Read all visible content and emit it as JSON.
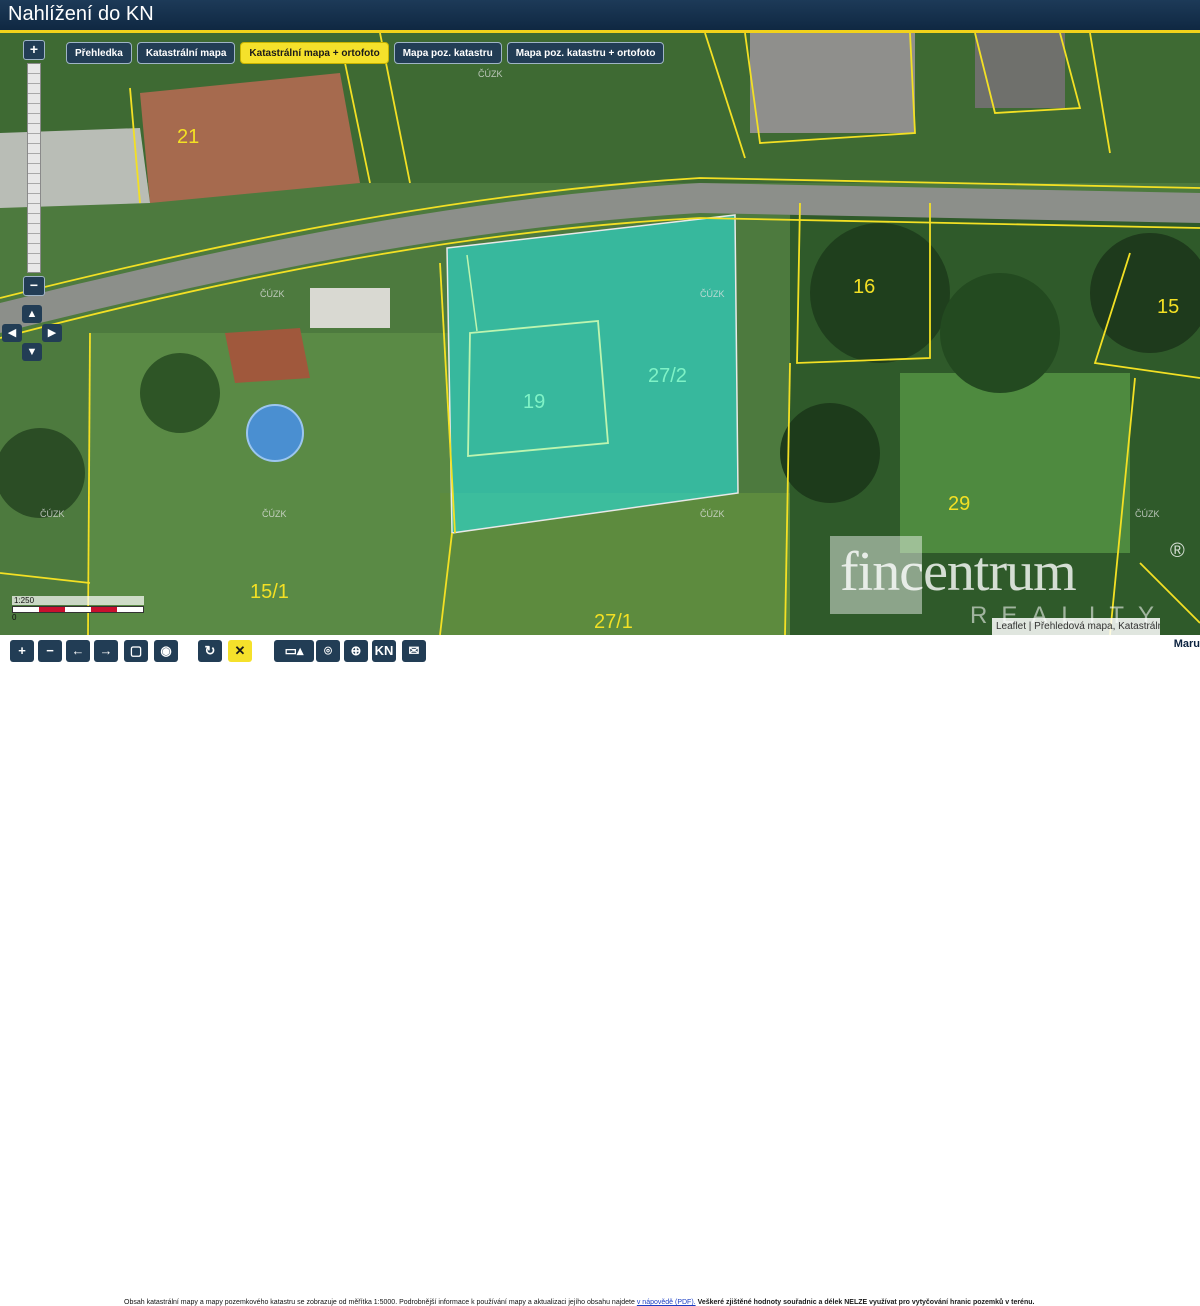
{
  "app": {
    "title": "Nahlížení do KN"
  },
  "layers": {
    "tabs": [
      {
        "label": "Přehledka",
        "active": false
      },
      {
        "label": "Katastrální mapa",
        "active": false
      },
      {
        "label": "Katastrální mapa + ortofoto",
        "active": true
      },
      {
        "label": "Mapa poz. katastru",
        "active": false
      },
      {
        "label": "Mapa poz. katastru + ortofoto",
        "active": false
      }
    ]
  },
  "zoom": {
    "in_label": "+",
    "out_label": "−"
  },
  "parcels": [
    {
      "label": "21"
    },
    {
      "label": "16"
    },
    {
      "label": "15"
    },
    {
      "label": "19"
    },
    {
      "label": "27/2"
    },
    {
      "label": "29"
    },
    {
      "label": "15/1"
    },
    {
      "label": "27/1"
    }
  ],
  "map": {
    "source_tag": "ČÚZK",
    "highlight_color": "#2fd0c2",
    "boundary_color": "#f3e024",
    "scale_label": "1:250",
    "scale_zero": "0"
  },
  "attribution": {
    "text": "Leaflet | Přehledová mapa, Katastrální mapa + o"
  },
  "watermark": {
    "brand": "fincentrum",
    "sub": "REALITY",
    "reg": "®"
  },
  "bottom_brand": "Maru",
  "toolbar": {
    "kn_label": "KN",
    "notice_text": "Obsah katastrální mapy a mapy pozemkového katastru se zobrazuje od měřítka 1:5000. Podrobnější informace k používání mapy a aktualizaci jejího obsahu najdete",
    "notice_link": "v nápovědě (PDF).",
    "notice_warning": "Veškeré zjištěné hodnoty souřadnic a délek NELZE využívat pro vytyčování hranic pozemků v terénu."
  }
}
